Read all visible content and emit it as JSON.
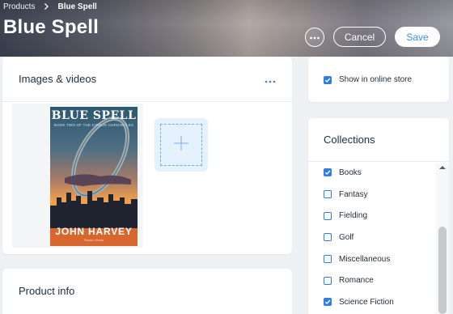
{
  "breadcrumb": {
    "parent": "Products",
    "current": "Blue Spell"
  },
  "header": {
    "title": "Blue Spell",
    "cancel_label": "Cancel",
    "save_label": "Save"
  },
  "media": {
    "title": "Images & videos",
    "book_cover": {
      "title": "BLUE SPELL",
      "subtitle": "BOOK TWO OF THE CIRRUS CHRONICLES",
      "author": "JOHN HARVEY",
      "publisher": "Phases • Books"
    }
  },
  "product_info": {
    "title": "Product info"
  },
  "online_store": {
    "label": "Show in online store",
    "checked": true
  },
  "collections": {
    "title": "Collections",
    "items": [
      {
        "label": "Books",
        "checked": true
      },
      {
        "label": "Fantasy",
        "checked": false
      },
      {
        "label": "Fielding",
        "checked": false
      },
      {
        "label": "Golf",
        "checked": false
      },
      {
        "label": "Miscellaneous",
        "checked": false
      },
      {
        "label": "Romance",
        "checked": false
      },
      {
        "label": "Science Fiction",
        "checked": true
      }
    ]
  },
  "colors": {
    "accent": "#2f7de1",
    "save_text": "#3b8ced",
    "page_bg": "#eef1f4"
  },
  "icons": [
    "chevron-right-icon",
    "more-icon",
    "add-icon",
    "checkbox-icon",
    "scroll-up-arrow-icon"
  ]
}
